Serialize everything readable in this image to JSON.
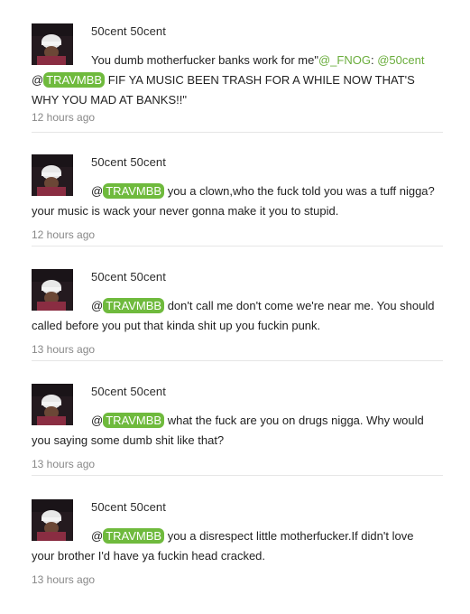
{
  "tweets": [
    {
      "author": "50cent 50cent",
      "pre": "You dumb motherfucker banks work for me\"",
      "link1": "@_FNOG",
      "sep": ": ",
      "link2": "@50cent",
      "mention_at": "@",
      "mention": "TRAVMBB",
      "body": " FIF YA MUSIC BEEN TRASH FOR A WHILE NOW THAT'S WHY YOU MAD AT BANKS!!\"",
      "time": "12 hours ago"
    },
    {
      "author": "50cent 50cent",
      "mention_at": "@",
      "mention": "TRAVMBB",
      "body": " you a clown,who the fuck told you was a tuff nigga?your music is wack your never gonna make it you to stupid.",
      "time": "12 hours ago"
    },
    {
      "author": "50cent 50cent",
      "mention_at": "@",
      "mention": "TRAVMBB",
      "body": " don't call me don't come we're near me. You should called before you put that kinda shit up you fuckin punk.",
      "time": "13 hours ago"
    },
    {
      "author": "50cent 50cent",
      "mention_at": "@",
      "mention": "TRAVMBB",
      "body": " what the fuck are you on drugs nigga. Why would you saying some dumb shit like that?",
      "time": "13 hours ago"
    },
    {
      "author": "50cent 50cent",
      "mention_at": "@",
      "mention": "TRAVMBB",
      "body": " you a disrespect little motherfucker.If didn't love your brother I'd have ya fuckin head cracked.",
      "time": "13 hours ago"
    }
  ]
}
